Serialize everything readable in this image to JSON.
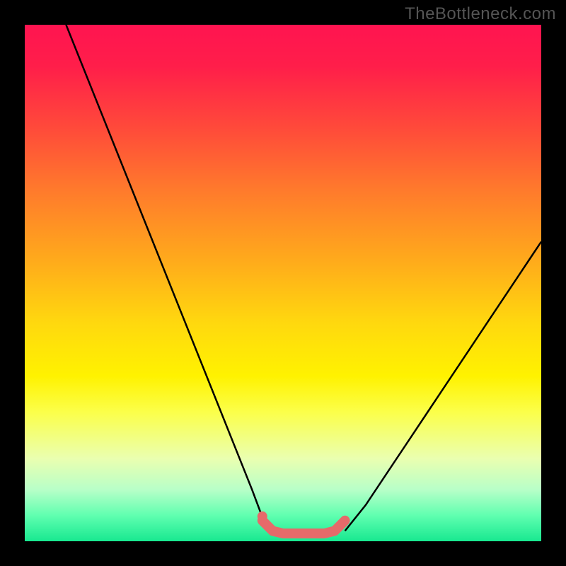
{
  "watermark": "TheBottleneck.com",
  "chart_data": {
    "type": "line",
    "title": "",
    "xlabel": "",
    "ylabel": "",
    "xlim": [
      0,
      100
    ],
    "ylim": [
      0,
      100
    ],
    "grid": false,
    "legend": false,
    "series": [
      {
        "name": "left-curve",
        "color": "#000000",
        "x": [
          8,
          12,
          16,
          20,
          24,
          28,
          32,
          36,
          40,
          44,
          47
        ],
        "values": [
          100,
          90,
          80,
          70,
          60,
          50,
          40,
          30,
          20,
          10,
          2
        ]
      },
      {
        "name": "right-curve",
        "color": "#000000",
        "x": [
          62,
          66,
          70,
          74,
          78,
          82,
          86,
          90,
          94,
          98,
          100
        ],
        "values": [
          2,
          7,
          13,
          19,
          25,
          31,
          37,
          43,
          49,
          55,
          58
        ]
      },
      {
        "name": "trough-marker",
        "color": "#e66a6a",
        "x": [
          46,
          48,
          50,
          52,
          54,
          56,
          58,
          60,
          62
        ],
        "values": [
          4,
          2,
          1.5,
          1.5,
          1.5,
          1.5,
          1.5,
          2,
          4
        ]
      }
    ],
    "gradient_stops": [
      {
        "pos": 0,
        "color": "#ff1450"
      },
      {
        "pos": 20,
        "color": "#ff4a3a"
      },
      {
        "pos": 45,
        "color": "#ffa81c"
      },
      {
        "pos": 68,
        "color": "#fff200"
      },
      {
        "pos": 90,
        "color": "#b8ffc8"
      },
      {
        "pos": 100,
        "color": "#18e890"
      }
    ]
  }
}
